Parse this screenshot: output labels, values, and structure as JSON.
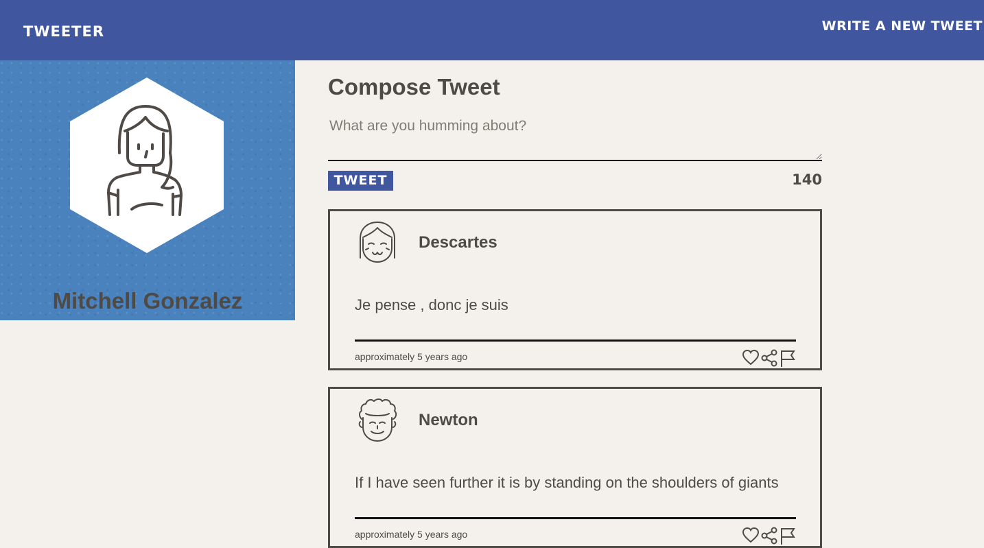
{
  "nav": {
    "brand": "Tweeter",
    "compose_link": "Write a new tweet"
  },
  "profile": {
    "name": "Mitchell Gonzalez",
    "avatar_icon": "woman-avatar-icon"
  },
  "composer": {
    "title": "Compose Tweet",
    "placeholder": "What are you humming about?",
    "button_label": "Tweet",
    "counter": "140"
  },
  "tweets": [
    {
      "author": "Descartes",
      "avatar_icon": "girl-avatar-icon",
      "text": "Je pense , donc je suis",
      "time": "approximately 5 years ago"
    },
    {
      "author": "Newton",
      "avatar_icon": "curly-hair-avatar-icon",
      "text": "If I have seen further it is by standing on the shoulders of giants",
      "time": "approximately 5 years ago"
    }
  ],
  "colors": {
    "nav": "#4057a0",
    "profile_bg": "#4a82bd",
    "page_bg": "#f4f1ec",
    "text": "#4f4a45"
  }
}
